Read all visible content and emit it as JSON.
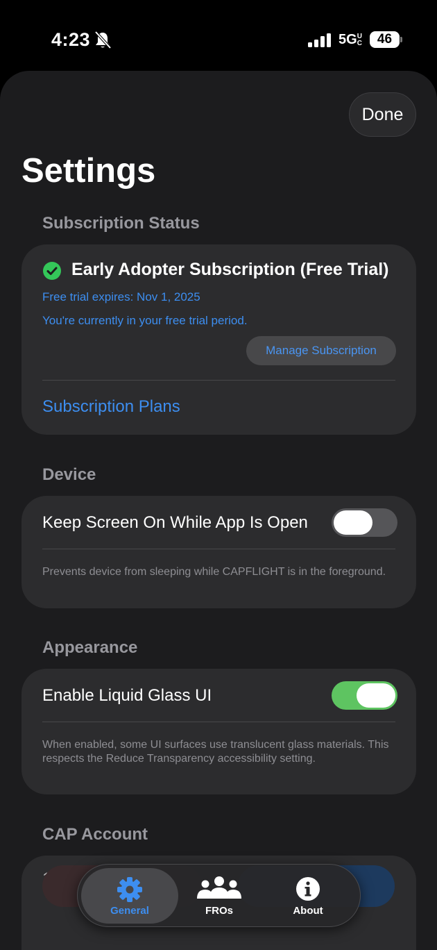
{
  "status_bar": {
    "time": "4:23",
    "network": "5G",
    "network_suffix": "UC",
    "battery": "46"
  },
  "header": {
    "done_label": "Done",
    "title": "Settings"
  },
  "subscription": {
    "header": "Subscription Status",
    "name": "Early Adopter Subscription (Free Trial)",
    "expires": "Free trial expires: Nov 1, 2025",
    "status": "You're currently in your free trial period.",
    "manage_label": "Manage Subscription",
    "plans_label": "Subscription Plans"
  },
  "device": {
    "header": "Device",
    "keep_screen_label": "Keep Screen On While App Is Open",
    "keep_screen_on": false,
    "footnote": "Prevents device from sleeping while CAPFLIGHT is in the foreground."
  },
  "appearance": {
    "header": "Appearance",
    "liquid_glass_label": "Enable Liquid Glass UI",
    "liquid_glass_on": true,
    "footnote": "When enabled, some UI surfaces use translucent glass materials. This respects the Reduce Transparency accessibility setting."
  },
  "account": {
    "header": "CAP Account",
    "value": "1386"
  },
  "tab_bar": {
    "tabs": [
      {
        "label": "General",
        "icon": "gear-icon",
        "selected": true
      },
      {
        "label": "FROs",
        "icon": "people-icon",
        "selected": false
      },
      {
        "label": "About",
        "icon": "info-icon",
        "selected": false
      }
    ]
  },
  "colors": {
    "accent": "#3d8ef0",
    "success": "#34c759",
    "toggle_on": "#5ec461",
    "background": "#1c1c1e",
    "card": "#2c2c2e"
  }
}
